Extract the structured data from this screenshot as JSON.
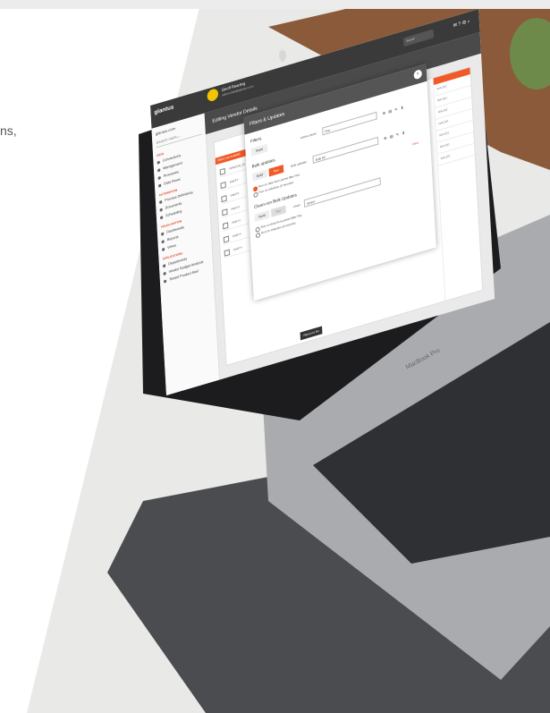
{
  "page": {
    "partial_text": "ns,"
  },
  "colors": {
    "accent": "#f05a28",
    "dark_header": "#3a3a3a",
    "background": "#ffffff"
  },
  "app": {
    "logo": "glantus",
    "user": {
      "name": "Geoff Reading",
      "subtitle": "admin.ideal@glantus.com"
    },
    "top_search_placeholder": "Search",
    "top_icons": "✉ ? ⚙ ⌕",
    "sidebar": {
      "domain": "glantus.com",
      "search_placeholder": "Search menu...",
      "sections": [
        {
          "title": "DATA",
          "items": [
            "Connections",
            "Management",
            "Processes",
            "Data Flows"
          ]
        },
        {
          "title": "AUTOMATION",
          "items": [
            "Process Definitions",
            "Documents",
            "Scheduling"
          ]
        },
        {
          "title": "VISUALISATION",
          "items": [
            "Dashboards",
            "Reports",
            "Views"
          ]
        },
        {
          "title": "APPLICATIONS",
          "items": [
            "Departments",
            "Vendor Budget Analysis",
            "Tenant Product Mail"
          ]
        }
      ]
    },
    "page_title": "Editing Vendor Details",
    "table": {
      "alert": "Filters are enabled. Clear",
      "rows": [
        "VENDOR_ID",
        "PARTY",
        "PARTY",
        "PARTY",
        "PARTY",
        "PARTY",
        "PARTY"
      ],
      "right_col": [
        "N/A 201",
        "N/A 201",
        "N/A 201",
        "N/A 201",
        "N/A 201",
        "N/A 201",
        "N/A 201"
      ]
    },
    "return_button": "Return to list",
    "modal": {
      "title": "Filters & Updates",
      "filters_label": "Filters",
      "build_button": "Build",
      "active_preset_label": "Active preset",
      "active_preset_value": "Flat",
      "bulk_updates_label": "Bulk updates",
      "run_button": "Run",
      "bulk_updates_select_label": "Bulk updates",
      "bulk_updates_select_value": "Bulk 95",
      "radio_1": "Run on data from preset filter Flat",
      "radio_2": "Run on selection (0 records)",
      "clean_run_label": "Clean-run Bulk Updates",
      "chain_label": "Chain",
      "chain_value": "Select",
      "clear_link": "Clear"
    }
  },
  "device": {
    "brand_text": "MacBook Pro"
  }
}
